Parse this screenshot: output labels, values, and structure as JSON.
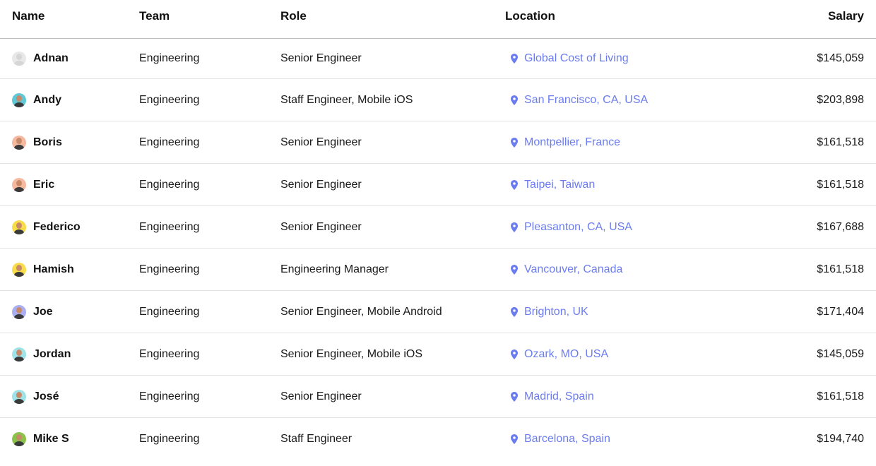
{
  "colors": {
    "accent": "#6b7cf0",
    "text": "#1a1a1a",
    "divider": "#e3e3e3"
  },
  "header": {
    "name": "Name",
    "team": "Team",
    "role": "Role",
    "location": "Location",
    "salary": "Salary"
  },
  "rows": [
    {
      "name": "Adnan",
      "team": "Engineering",
      "role": "Senior Engineer",
      "location": "Global Cost of Living",
      "salary": "$145,059",
      "avatar_bg": "#e8e8e8",
      "avatar_icon": "default-avatar-icon"
    },
    {
      "name": "Andy",
      "team": "Engineering",
      "role": "Staff Engineer, Mobile iOS",
      "location": "San Francisco, CA, USA",
      "salary": "$203,898",
      "avatar_bg": "#5ec8d6",
      "avatar_icon": "user-photo-icon"
    },
    {
      "name": "Boris",
      "team": "Engineering",
      "role": "Senior Engineer",
      "location": "Montpellier, France",
      "salary": "$161,518",
      "avatar_bg": "#f5b9a0",
      "avatar_icon": "user-photo-icon"
    },
    {
      "name": "Eric",
      "team": "Engineering",
      "role": "Senior Engineer",
      "location": "Taipei, Taiwan",
      "salary": "$161,518",
      "avatar_bg": "#f5b9a0",
      "avatar_icon": "user-photo-icon"
    },
    {
      "name": "Federico",
      "team": "Engineering",
      "role": "Senior Engineer",
      "location": "Pleasanton, CA, USA",
      "salary": "$167,688",
      "avatar_bg": "#f7dd4a",
      "avatar_icon": "user-photo-icon"
    },
    {
      "name": "Hamish",
      "team": "Engineering",
      "role": "Engineering Manager",
      "location": "Vancouver, Canada",
      "salary": "$161,518",
      "avatar_bg": "#f7dd4a",
      "avatar_icon": "user-photo-icon"
    },
    {
      "name": "Joe",
      "team": "Engineering",
      "role": "Senior Engineer, Mobile Android",
      "location": "Brighton, UK",
      "salary": "$171,404",
      "avatar_bg": "#a9aef0",
      "avatar_icon": "user-photo-icon"
    },
    {
      "name": "Jordan",
      "team": "Engineering",
      "role": "Senior Engineer, Mobile iOS",
      "location": "Ozark, MO, USA",
      "salary": "$145,059",
      "avatar_bg": "#9fe3e8",
      "avatar_icon": "user-photo-icon"
    },
    {
      "name": "José",
      "team": "Engineering",
      "role": "Senior Engineer",
      "location": "Madrid, Spain",
      "salary": "$161,518",
      "avatar_bg": "#9fe3e8",
      "avatar_icon": "user-photo-icon"
    },
    {
      "name": "Mike S",
      "team": "Engineering",
      "role": "Staff Engineer",
      "location": "Barcelona, Spain",
      "salary": "$194,740",
      "avatar_bg": "#8bc34a",
      "avatar_icon": "user-photo-icon"
    }
  ]
}
